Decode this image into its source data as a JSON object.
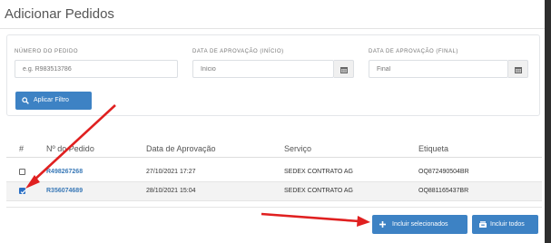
{
  "modal": {
    "title": "Adicionar Pedidos"
  },
  "filters": {
    "order_number": {
      "label": "NÚMERO DO PEDIDO",
      "placeholder": "e.g. R983513786"
    },
    "date_start": {
      "label": "DATA DE APROVAÇÃO (INÍCIO)",
      "placeholder": "Início"
    },
    "date_end": {
      "label": "DATA DE APROVAÇÃO (FINAL)",
      "placeholder": "Final"
    },
    "apply_label": "Aplicar Filtro"
  },
  "table": {
    "columns": [
      "#",
      "Nº do Pedido",
      "Data de Aprovação",
      "Serviço",
      "Etiqueta"
    ],
    "rows": [
      {
        "checked": false,
        "order": "R498267268",
        "date": "27/10/2021 17:27",
        "service": "SEDEX CONTRATO AG",
        "label": "OQ872490504BR"
      },
      {
        "checked": true,
        "order": "R356074689",
        "date": "28/10/2021 15:04",
        "service": "SEDEX CONTRATO AG",
        "label": "OQ881165437BR"
      }
    ]
  },
  "actions": {
    "include_selected": "Incluir selecionados",
    "include_all": "Incluir todos"
  },
  "colors": {
    "primary": "#3d82c4",
    "link": "#3a79b7",
    "annotation": "#e02020"
  },
  "icons": {
    "apply": "search-icon",
    "include_selected": "plus-icon",
    "include_all": "inbox-icon",
    "calendar": "calendar-icon"
  }
}
